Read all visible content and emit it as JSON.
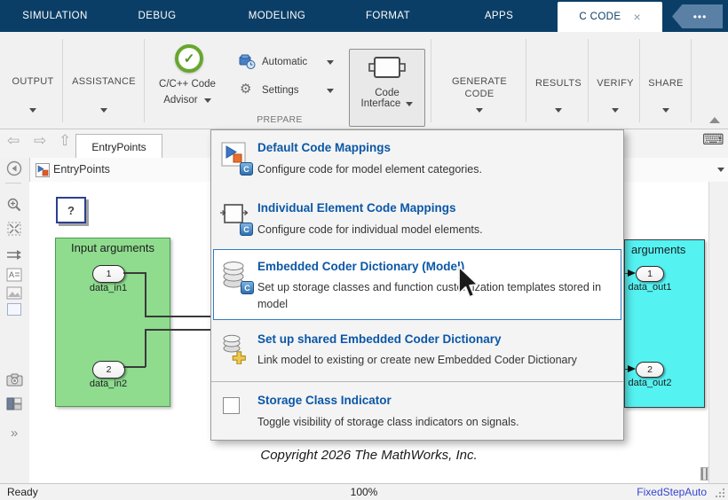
{
  "tabbar": {
    "tabs": [
      "SIMULATION",
      "DEBUG",
      "MODELING",
      "FORMAT",
      "APPS"
    ],
    "active_tab": "C CODE",
    "close": "×",
    "more": "•••"
  },
  "ribbon": {
    "output": "OUTPUT",
    "assistance": "ASSISTANCE",
    "advisor_line1": "C/C++ Code",
    "advisor_line2": "Advisor",
    "automatic": "Automatic",
    "settings": "Settings",
    "prepare_group": "PREPARE",
    "code_interface_line1": "Code",
    "code_interface_line2": "Interface",
    "generate_line1": "GENERATE",
    "generate_line2": "CODE",
    "results": "RESULTS",
    "verify": "VERIFY",
    "share": "SHARE"
  },
  "navbar": {
    "doc_tab": "EntryPoints"
  },
  "breadcrumb": {
    "item": "EntryPoints"
  },
  "menu": {
    "items": [
      {
        "title": "Default Code Mappings",
        "desc": "Configure code for model element categories."
      },
      {
        "title": "Individual Element Code Mappings",
        "desc": "Configure code for individual model elements."
      },
      {
        "title": "Embedded Coder Dictionary (Model)",
        "desc": "Set up storage classes and function customization templates stored in model"
      },
      {
        "title": "Set up shared Embedded Coder Dictionary",
        "desc": "Link model to existing or create new Embedded Coder Dictionary"
      },
      {
        "title": "Storage Class Indicator",
        "desc": "Toggle visibility of storage class indicators on signals."
      }
    ]
  },
  "canvas": {
    "unknown_block": "?",
    "input_block": {
      "title": "Input arguments",
      "port1": "1",
      "port1_label": "data_in1",
      "port2": "2",
      "port2_label": "data_in2"
    },
    "output_block": {
      "title": "arguments",
      "port1": "1",
      "port1_label": "data_out1",
      "port2": "2",
      "port2_label": "data_out2"
    },
    "copyright": "Copyright 2026 The MathWorks, Inc."
  },
  "statusbar": {
    "left": "Ready",
    "center": "100%",
    "right": "FixedStepAuto"
  },
  "icons": {
    "gear": "⚙",
    "check": "✓",
    "keyboard": "⌨",
    "c_badge": "C",
    "nav_back": "⇦",
    "nav_forward": "⇨",
    "nav_up": "⇧",
    "palette_more": "»"
  },
  "colors": {
    "navy": "#0b3e66",
    "menu_title_blue": "#0b57a6",
    "highlight_border": "#2e7dc2",
    "green_block": "#8fdc8f",
    "cyan_block": "#55f2f2",
    "status_link": "#3545cf"
  }
}
